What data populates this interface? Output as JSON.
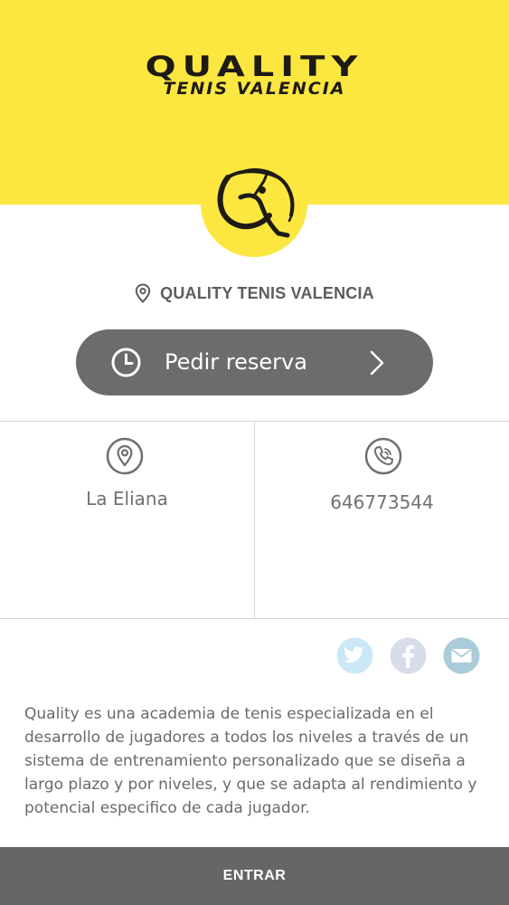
{
  "header": {
    "logo_main": "QUALITY",
    "logo_sub": "TENIS VALENCIA",
    "background_color": "#fbe73f"
  },
  "club": {
    "name": "QUALITY TENIS VALENCIA",
    "icon": "location-pin-icon"
  },
  "reserve": {
    "label": "Pedir reserva",
    "icon": "clock-icon",
    "arrow_icon": "chevron-right-icon",
    "color": "#6c6b6e"
  },
  "info": {
    "location": {
      "icon": "location-pin-icon",
      "value": "La Eliana"
    },
    "phone": {
      "icon": "phone-icon",
      "value": "646773544"
    }
  },
  "share": {
    "items": [
      {
        "name": "twitter",
        "icon": "twitter-icon",
        "color": "#cbe8f6"
      },
      {
        "name": "facebook",
        "icon": "facebook-icon",
        "color": "#d7dde9"
      },
      {
        "name": "email",
        "icon": "email-icon",
        "color": "#a9ccd9"
      }
    ]
  },
  "description": "Quality es una academia de tenis especializada en el desarrollo de jugadores a todos los niveles a través de un sistema de entrenamiento personalizado que se diseña a largo plazo y por niveles, y que se adapta al rendimiento y potencial especifico de cada jugador.",
  "footer": {
    "enter_label": "ENTRAR"
  }
}
